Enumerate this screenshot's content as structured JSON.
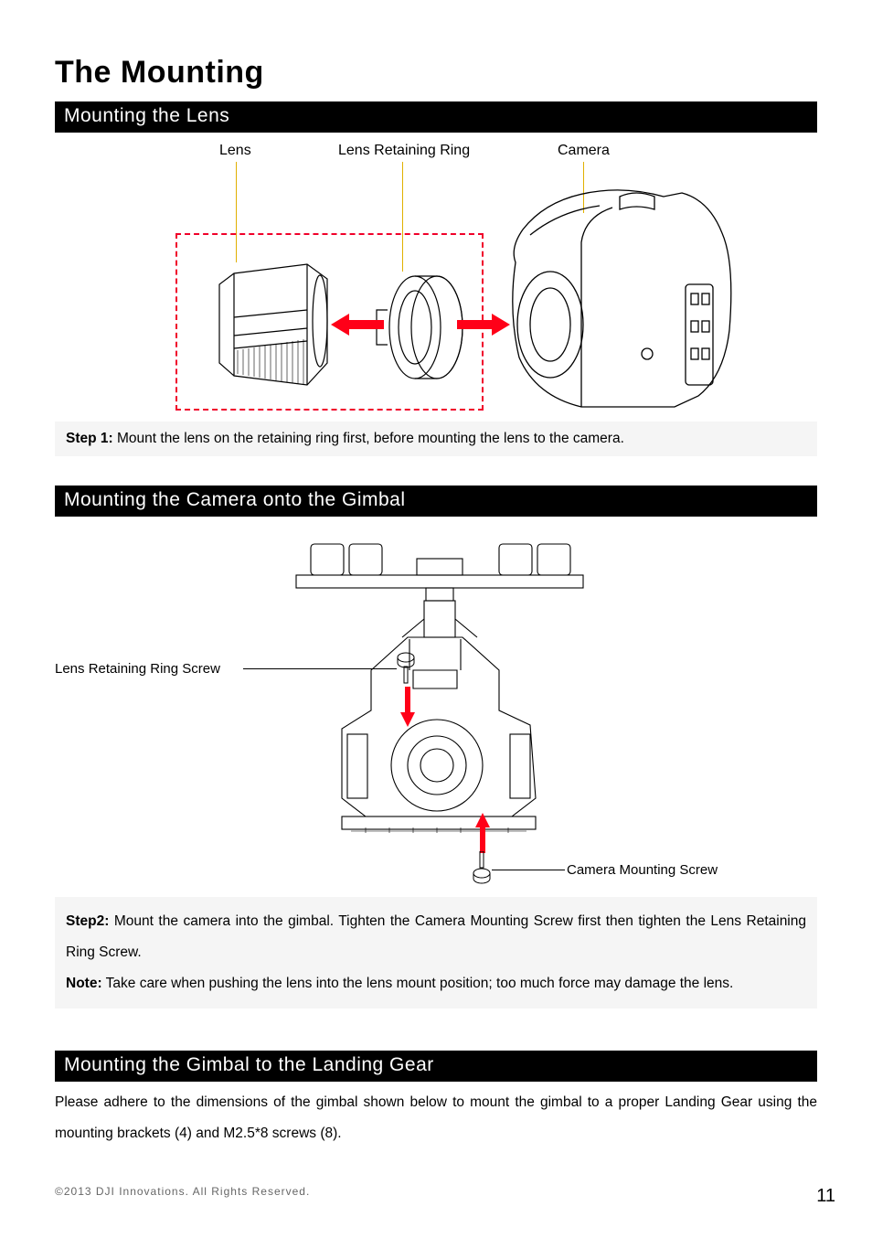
{
  "title": "The Mounting",
  "sections": {
    "lens": {
      "heading": "Mounting the Lens",
      "labels": {
        "lens": "Lens",
        "ring": "Lens Retaining Ring",
        "camera": "Camera"
      },
      "step_label": "Step 1:",
      "step_text": "Mount the lens on the retaining ring first, before mounting the lens to the camera."
    },
    "gimbal": {
      "heading": "Mounting the Camera onto the Gimbal",
      "labels": {
        "ring_screw": "Lens Retaining Ring Screw",
        "cam_screw": "Camera Mounting Screw"
      },
      "step_label": "Step2:",
      "step_text": "Mount the camera into the gimbal. Tighten the Camera Mounting Screw first then tighten the Lens Retaining Ring Screw.",
      "note_label": "Note:",
      "note_text": "Take care when pushing the lens into the lens mount position; too much force may damage the lens."
    },
    "landing": {
      "heading": "Mounting the Gimbal to the Landing Gear",
      "body": "Please adhere to the dimensions of the gimbal shown below to mount the gimbal to a proper Landing Gear using the mounting brackets (4) and M2.5*8 screws (8)."
    }
  },
  "footer": "©2013 DJI Innovations. All Rights Reserved.",
  "page_number": "11"
}
